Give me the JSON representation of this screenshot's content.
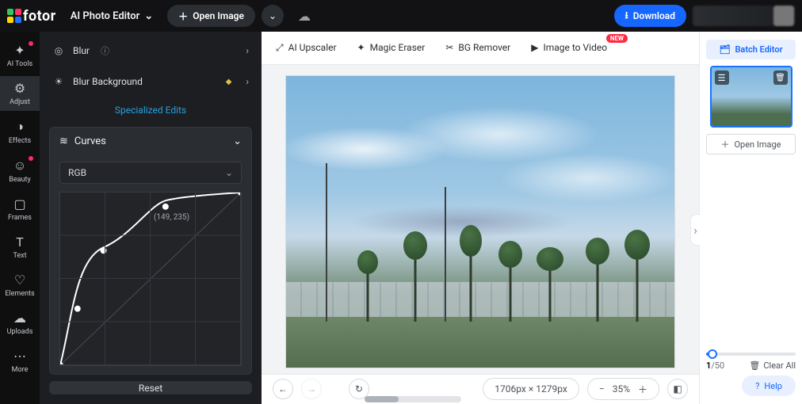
{
  "brand": "fotor",
  "top": {
    "mode": "AI Photo Editor",
    "open": "Open Image",
    "download": "Download"
  },
  "rail": [
    {
      "label": "AI Tools",
      "icon": "✦",
      "dot": true
    },
    {
      "label": "Adjust",
      "icon": "⚙",
      "active": true
    },
    {
      "label": "Effects",
      "icon": "◑"
    },
    {
      "label": "Beauty",
      "icon": "☺",
      "dot": true
    },
    {
      "label": "Frames",
      "icon": "▢"
    },
    {
      "label": "Text",
      "icon": "T"
    },
    {
      "label": "Elements",
      "icon": "♡"
    },
    {
      "label": "Uploads",
      "icon": "☁"
    },
    {
      "label": "More",
      "icon": "⋯"
    }
  ],
  "panel": {
    "blur": "Blur",
    "blur_bg": "Blur Background",
    "section": "Specialized Edits",
    "curves": "Curves",
    "channel": "RGB",
    "coord": "(149, 235)",
    "reset": "Reset"
  },
  "tabs": [
    {
      "label": "AI Upscaler",
      "icon": "⤢"
    },
    {
      "label": "Magic Eraser",
      "icon": "✦"
    },
    {
      "label": "BG Remover",
      "icon": "✂"
    },
    {
      "label": "Image to Video",
      "icon": "▶",
      "new": "NEW"
    }
  ],
  "canvas": {
    "dimensions": "1706px × 1279px",
    "zoom": "35%"
  },
  "right": {
    "batch": "Batch Editor",
    "open_image": "Open Image",
    "count_cur": "1",
    "count_max": "/50",
    "clear": "Clear All",
    "help": "Help"
  }
}
